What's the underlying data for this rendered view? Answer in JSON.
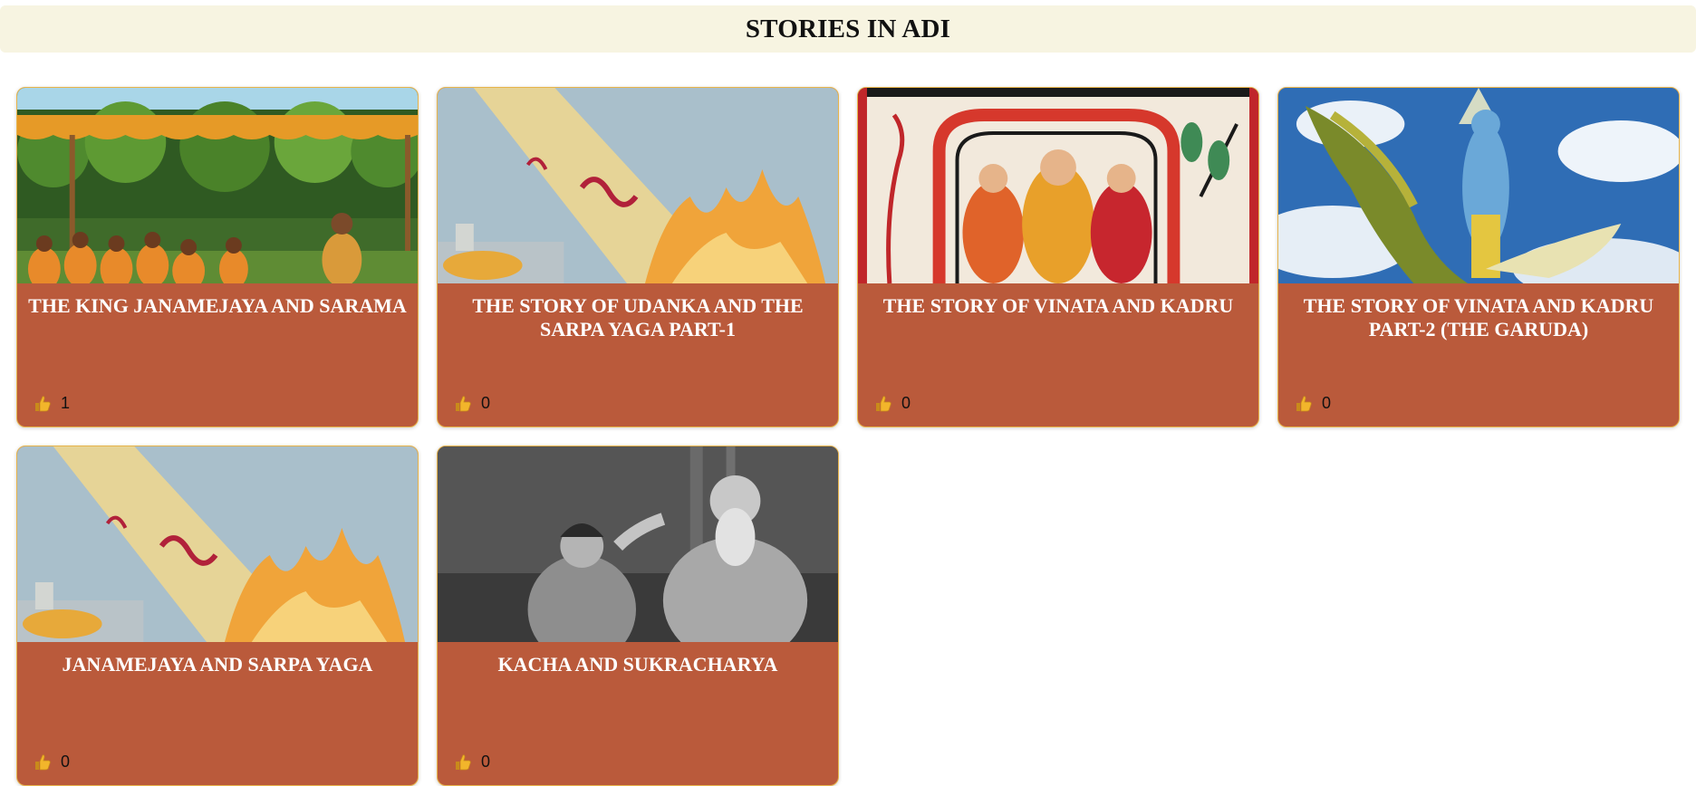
{
  "header": {
    "title": "STORIES IN ADI"
  },
  "colors": {
    "card_bg": "#ba5a3b",
    "card_border": "#e8b44a",
    "header_bg": "#f7f4e1"
  },
  "stories": [
    {
      "title": "THE KING JANAMEJAYA AND SARAMA",
      "likes": "1",
      "image": "sages-in-forest-pavilion"
    },
    {
      "title": "THE STORY OF UDANKA AND THE SARPA YAGA PART-1",
      "likes": "0",
      "image": "serpents-into-fire-sacrifice"
    },
    {
      "title": "THE STORY OF VINATA AND KADRU",
      "likes": "0",
      "image": "madhubani-painting-sage-with-wives"
    },
    {
      "title": "THE STORY OF VINATA AND KADRU PART-2 (THE GARUDA)",
      "likes": "0",
      "image": "vishnu-on-garuda-in-sky"
    },
    {
      "title": "JANAMEJAYA AND SARPA YAGA",
      "likes": "0",
      "image": "serpents-into-fire-sacrifice"
    },
    {
      "title": "KACHA AND SUKRACHARYA",
      "likes": "0",
      "image": "guru-blessing-disciple"
    }
  ],
  "like_icon": "thumbs-up-icon"
}
